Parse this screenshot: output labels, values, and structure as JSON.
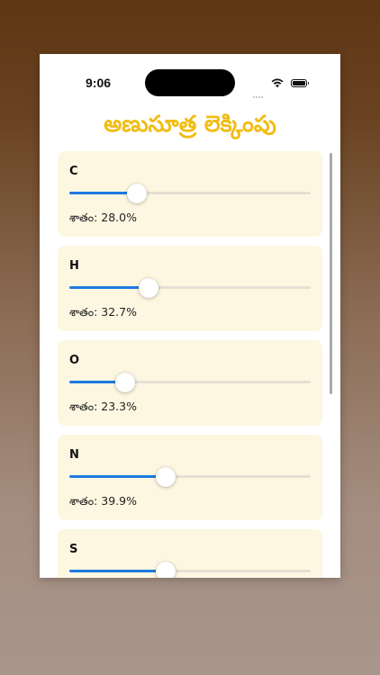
{
  "status_bar": {
    "time": "9:06"
  },
  "title": "అణుసూత్ర లెక్కింపు",
  "percent_prefix": "శాతం:",
  "elements": [
    {
      "label": "C",
      "value": 0.28,
      "percent": "శాతం: 28.0%"
    },
    {
      "label": "H",
      "value": 0.327,
      "percent": "శాతం: 32.7%"
    },
    {
      "label": "O",
      "value": 0.233,
      "percent": "శాతం: 23.3%"
    },
    {
      "label": "N",
      "value": 0.399,
      "percent": "శాతం: 39.9%"
    },
    {
      "label": "S",
      "value": 0.4,
      "percent": ""
    }
  ],
  "colors": {
    "title": "#f0bd14",
    "card_background": "#fdf7e1",
    "slider_fill": "#1f7ae0",
    "slider_track": "#e5e0d4"
  }
}
